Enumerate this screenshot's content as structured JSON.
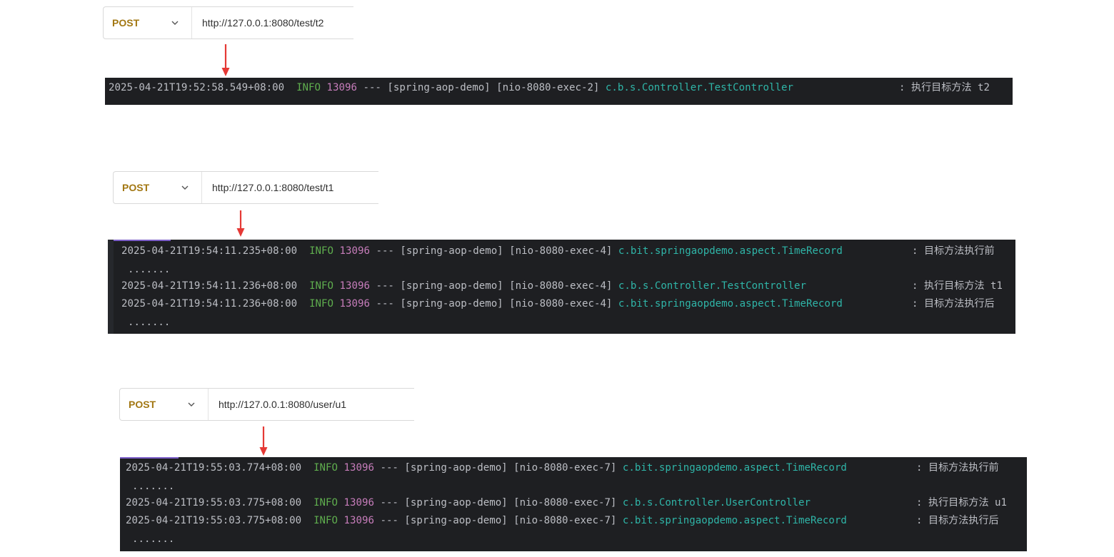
{
  "requests": [
    {
      "method": "POST",
      "url": "http://127.0.0.1:8080/test/t2"
    },
    {
      "method": "POST",
      "url": "http://127.0.0.1:8080/test/t1"
    },
    {
      "method": "POST",
      "url": "http://127.0.0.1:8080/user/u1"
    }
  ],
  "colors": {
    "method": "#a27712",
    "arrow": "#e53935",
    "console_bg": "#1e1f22",
    "level_info": "#5fae4e",
    "pid": "#c77dbb",
    "logger": "#2fb5a8"
  },
  "logs": [
    {
      "lines": [
        {
          "ts": "2025-04-21T19:52:58.549+08:00",
          "level": "INFO",
          "pid": "13096",
          "sep": "---",
          "app": "[spring-aop-demo]",
          "thread": "[nio-8080-exec-2]",
          "logger": "c.b.s.Controller.TestController",
          "colon": ":",
          "msg": "执行目标方法 t2",
          "cont": ""
        }
      ]
    },
    {
      "lines": [
        {
          "ts": "2025-04-21T19:54:11.235+08:00",
          "level": "INFO",
          "pid": "13096",
          "sep": "---",
          "app": "[spring-aop-demo]",
          "thread": "[nio-8080-exec-4]",
          "logger": "c.bit.springaopdemo.aspect.TimeRecord",
          "colon": ":",
          "msg": "目标方法执行前",
          "cont": "......."
        },
        {
          "ts": "2025-04-21T19:54:11.236+08:00",
          "level": "INFO",
          "pid": "13096",
          "sep": "---",
          "app": "[spring-aop-demo]",
          "thread": "[nio-8080-exec-4]",
          "logger": "c.b.s.Controller.TestController",
          "colon": ":",
          "msg": "执行目标方法 t1",
          "cont": ""
        },
        {
          "ts": "2025-04-21T19:54:11.236+08:00",
          "level": "INFO",
          "pid": "13096",
          "sep": "---",
          "app": "[spring-aop-demo]",
          "thread": "[nio-8080-exec-4]",
          "logger": "c.bit.springaopdemo.aspect.TimeRecord",
          "colon": ":",
          "msg": "目标方法执行后",
          "cont": "......."
        }
      ]
    },
    {
      "lines": [
        {
          "ts": "2025-04-21T19:55:03.774+08:00",
          "level": "INFO",
          "pid": "13096",
          "sep": "---",
          "app": "[spring-aop-demo]",
          "thread": "[nio-8080-exec-7]",
          "logger": "c.bit.springaopdemo.aspect.TimeRecord",
          "colon": ":",
          "msg": "目标方法执行前",
          "cont": "......."
        },
        {
          "ts": "2025-04-21T19:55:03.775+08:00",
          "level": "INFO",
          "pid": "13096",
          "sep": "---",
          "app": "[spring-aop-demo]",
          "thread": "[nio-8080-exec-7]",
          "logger": "c.b.s.Controller.UserController",
          "colon": ":",
          "msg": "执行目标方法 u1",
          "cont": ""
        },
        {
          "ts": "2025-04-21T19:55:03.775+08:00",
          "level": "INFO",
          "pid": "13096",
          "sep": "---",
          "app": "[spring-aop-demo]",
          "thread": "[nio-8080-exec-7]",
          "logger": "c.bit.springaopdemo.aspect.TimeRecord",
          "colon": ":",
          "msg": "目标方法执行后",
          "cont": "......."
        }
      ]
    }
  ]
}
